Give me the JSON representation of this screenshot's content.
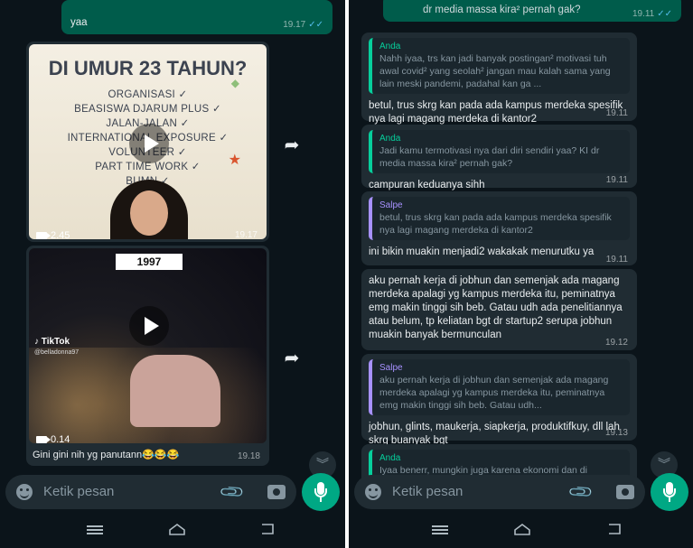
{
  "left": {
    "top_bubble": {
      "text": "yaa",
      "time": "19.17"
    },
    "video1": {
      "title_line1": "DI UMUR 23 TAHUN?",
      "items": [
        "ORGANISASI ✓",
        "BEASISWA DJARUM PLUS ✓",
        "JALAN-JALAN ✓",
        "INTERNATIONAL EXPOSURE ✓",
        "VOLUNTEER ✓",
        "PART TIME WORK ✓",
        "BUMN ✓"
      ],
      "duration": "2.45",
      "time": "19.17"
    },
    "video2": {
      "year": "1997",
      "tiktok": "TikTok",
      "handle": "@belladonna97",
      "duration": "0.14",
      "caption": "Gini gini nih yg panutann😂😂😂",
      "time": "19.18"
    },
    "composer": {
      "placeholder": "Ketik pesan"
    }
  },
  "right": {
    "top_bubble": {
      "text": "dr media massa kira² pernah gak?",
      "time": "19.11"
    },
    "messages": [
      {
        "quote_name": "Anda",
        "quote_text": "Nahh iyaa, trs kan jadi banyak postingan² motivasi tuh awal covid² yang seolah² jangan mau kalah sama yang lain meski pandemi, padahal kan ga ...",
        "text": "betul, trus skrg kan pada ada kampus merdeka spesifik nya lagi magang merdeka di kantor2",
        "time": "19.11"
      },
      {
        "quote_name": "Anda",
        "quote_text": "Jadi kamu termotivasi nya dari diri sendiri yaa? KI dr media massa kira² pernah gak?",
        "text": "campuran keduanya sihh",
        "time": "19.11"
      },
      {
        "quote_name": "Salpe",
        "quote_text": "betul, trus skrg kan pada ada kampus merdeka spesifik nya lagi magang merdeka di kantor2",
        "text": "ini bikin muakin menjadi2 wakakak menurutku ya",
        "time": "19.11"
      },
      {
        "text": "aku pernah kerja di jobhun dan semenjak ada magang merdeka apalagi yg kampus merdeka itu, peminatnya emg makin tinggi sih beb. Gatau udh ada penelitiannya atau belum, tp keliatan bgt dr startup2 serupa jobhun muakin banyak bermunculan",
        "time": "19.12"
      },
      {
        "quote_name": "Salpe",
        "quote_text": "aku pernah kerja di jobhun dan semenjak ada magang merdeka apalagi yg kampus merdeka itu, peminatnya emg makin tinggi sih beb. Gatau udh...",
        "text": "jobhun, glints, maukerja, siapkerja, produktifkuy, dll lah skrg buanyak bgt",
        "time": "19.13"
      },
      {
        "quote_name": "Anda",
        "quote_text": "Iyaa benerr, mungkin juga karena ekonomi dan di indonesia sendiri kan masih banyak ortu yang"
      }
    ],
    "composer": {
      "placeholder": "Ketik pesan"
    }
  },
  "colors": {
    "bg": "#0b141a",
    "bubble_in": "#202c33",
    "bubble_out": "#005c4b",
    "accent": "#00a884",
    "quote_green": "#06cf9c",
    "quote_purple": "#a791ff"
  }
}
